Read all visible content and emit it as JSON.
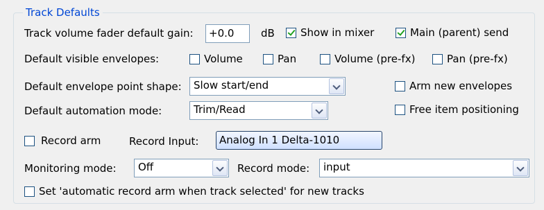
{
  "group": {
    "title": "Track Defaults"
  },
  "row1": {
    "fader_label": "Track volume fader default gain:",
    "fader_value": "+0.0",
    "fader_unit": "dB",
    "show_in_mixer": "Show in mixer",
    "main_send": "Main (parent) send"
  },
  "row2": {
    "label": "Default visible envelopes:",
    "volume": "Volume",
    "pan": "Pan",
    "volume_prefx": "Volume (pre-fx)",
    "pan_prefx": "Pan (pre-fx)"
  },
  "row3": {
    "label": "Default envelope point shape:",
    "value": "Slow start/end",
    "arm_new_envelopes": "Arm new envelopes"
  },
  "row4": {
    "label": "Default automation mode:",
    "value": "Trim/Read",
    "free_item_positioning": "Free item positioning"
  },
  "row5": {
    "record_arm": "Record arm",
    "record_input_label": "Record Input:",
    "record_input_value": "Analog In 1 Delta-1010"
  },
  "row6": {
    "monitoring_label": "Monitoring mode:",
    "monitoring_value": "Off",
    "record_mode_label": "Record mode:",
    "record_mode_value": "input"
  },
  "row7": {
    "auto_arm": "Set 'automatic record arm when track selected' for new tracks"
  },
  "checkboxes": {
    "show_in_mixer": true,
    "main_send": true,
    "volume": false,
    "pan": false,
    "volume_prefx": false,
    "pan_prefx": false,
    "arm_new_envelopes": false,
    "free_item_positioning": false,
    "record_arm": false,
    "auto_arm": false
  },
  "colors": {
    "legend": "#0046d5",
    "check": "#21a121",
    "border": "#1c5180"
  }
}
